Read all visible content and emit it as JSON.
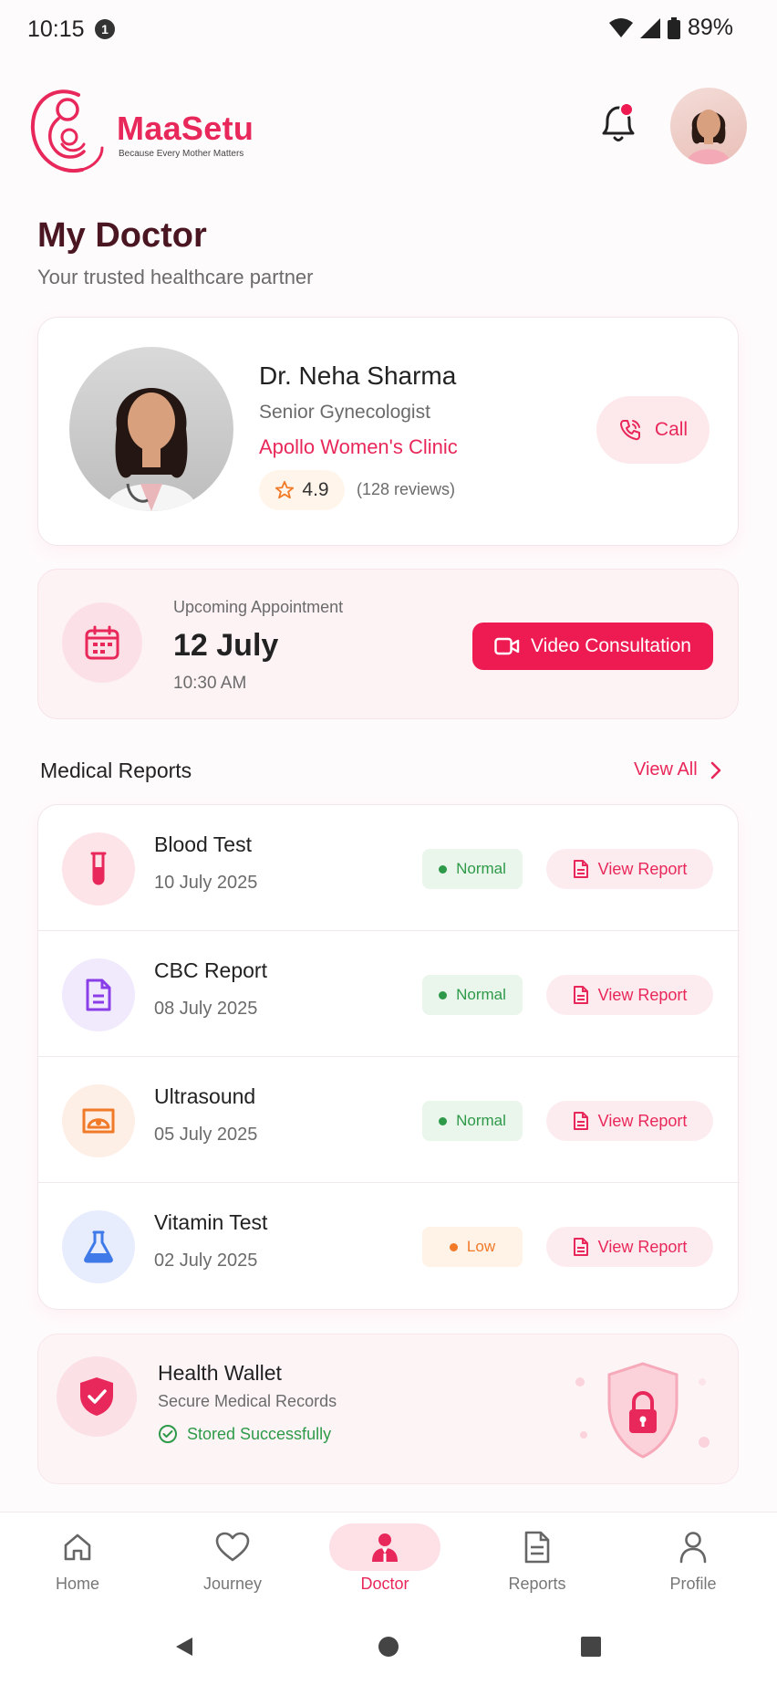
{
  "status_bar": {
    "time": "10:15",
    "notification_count": "1",
    "battery": "89%"
  },
  "header": {
    "brand": "MaaSetu",
    "tagline": "Because Every Mother Matters"
  },
  "page": {
    "title": "My Doctor",
    "subtitle": "Your trusted healthcare partner"
  },
  "doctor": {
    "name": "Dr. Neha Sharma",
    "role": "Senior Gynecologist",
    "clinic": "Apollo Women's Clinic",
    "rating": "4.9",
    "reviews": "(128 reviews)",
    "call_label": "Call"
  },
  "appointment": {
    "label": "Upcoming Appointment",
    "date": "12 July",
    "time": "10:30 AM",
    "button_label": "Video Consultation"
  },
  "reports": {
    "section_title": "Medical Reports",
    "view_all": "View All",
    "view_report_label": "View Report",
    "items": [
      {
        "name": "Blood Test",
        "date": "10 July 2025",
        "status": "Normal",
        "icon": "test-tube-icon"
      },
      {
        "name": "CBC Report",
        "date": "08 July 2025",
        "status": "Normal",
        "icon": "document-icon"
      },
      {
        "name": "Ultrasound",
        "date": "05 July 2025",
        "status": "Normal",
        "icon": "ultrasound-icon"
      },
      {
        "name": "Vitamin Test",
        "date": "02 July 2025",
        "status": "Low",
        "icon": "flask-icon"
      }
    ]
  },
  "wallet": {
    "title": "Health Wallet",
    "subtitle": "Secure Medical Records",
    "status": "Stored Successfully"
  },
  "nav": {
    "home": "Home",
    "journey": "Journey",
    "doctor": "Doctor",
    "reports": "Reports",
    "profile": "Profile",
    "active": "Doctor"
  },
  "colors": {
    "accent": "#e8285a",
    "normal": "#2e9a49",
    "low": "#f07a28"
  }
}
